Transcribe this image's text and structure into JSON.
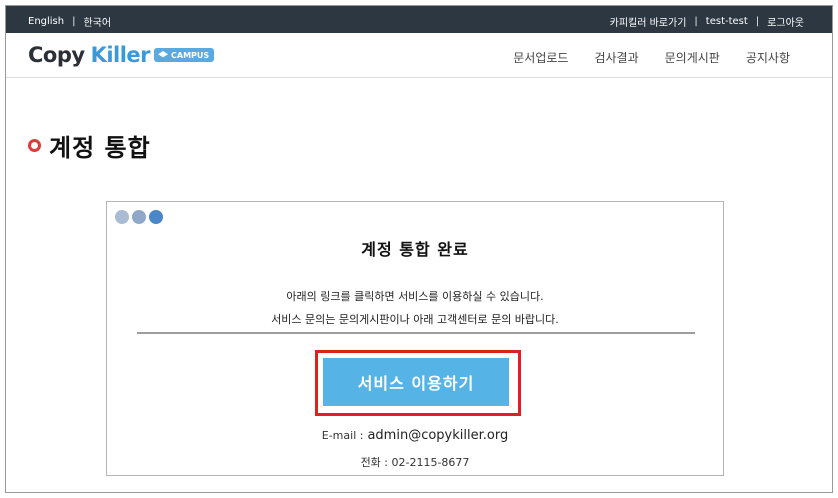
{
  "topbar": {
    "lang_en": "English",
    "lang_ko": "한국어",
    "separator": "|",
    "link_home": "카피킬러 바로가기",
    "user": "test-test",
    "logout": "로그아웃"
  },
  "header": {
    "logo_copy": "Copy",
    "logo_killer": "Killer",
    "logo_campus": "CAMPUS",
    "nav": [
      "문서업로드",
      "검사결과",
      "문의게시판",
      "공지사항"
    ]
  },
  "page": {
    "title": "계정 통합"
  },
  "card": {
    "dot_colors": [
      "#a9bcd3",
      "#8fa8c9",
      "#4a86c8"
    ],
    "heading": "계정 통합 완료",
    "line1": "아래의 링크를 클릭하면 서비스를 이용하실 수 있습니다.",
    "line2": "서비스 문의는 문의게시판이나 아래 고객센터로 문의 바랍니다.",
    "button": "서비스 이용하기",
    "email_label": "E-mail :",
    "email": "admin@copykiller.org",
    "phone": "전화 : 02-2115-8677"
  },
  "colors": {
    "topbar_bg": "#2d3742",
    "accent_blue": "#56b3e6",
    "highlight_red": "#e01f1f",
    "title_ring": "#e23a3a"
  }
}
